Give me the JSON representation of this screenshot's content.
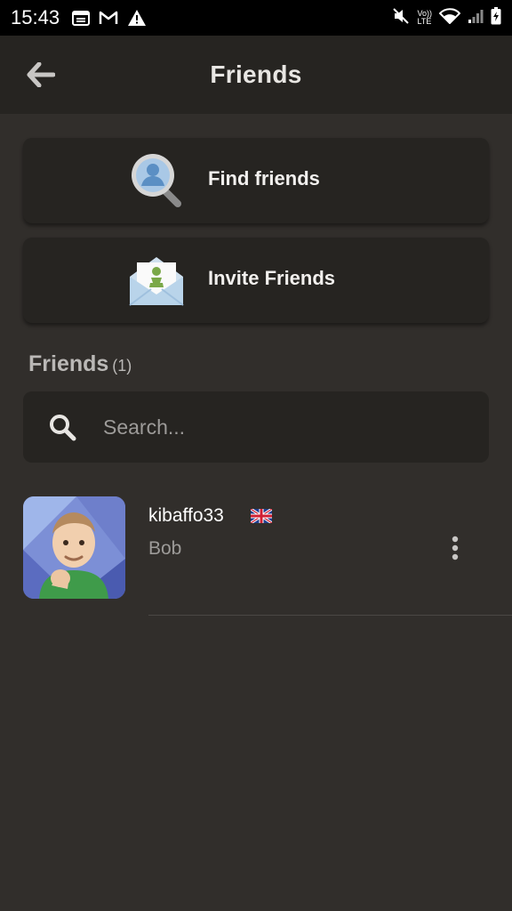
{
  "status_bar": {
    "time": "15:43",
    "left_icons": [
      "calendar-icon",
      "gmail-icon",
      "warning-icon"
    ],
    "right_icons": [
      "mute-icon",
      "volte-icon",
      "wifi-icon",
      "signal-icon",
      "battery-icon"
    ],
    "volte_top": "Vo))",
    "volte_bottom": "LTE"
  },
  "app_bar": {
    "title": "Friends"
  },
  "actions": [
    {
      "label": "Find friends",
      "icon": "magnifier-person-icon"
    },
    {
      "label": "Invite Friends",
      "icon": "envelope-pawn-icon"
    }
  ],
  "friends_section": {
    "title": "Friends",
    "count": "(1)"
  },
  "search": {
    "placeholder": "Search..."
  },
  "friends": [
    {
      "username": "kibaffo33",
      "real_name": "Bob",
      "country_flag": "uk-flag-icon",
      "avatar": "baby-fist-avatar"
    }
  ],
  "colors": {
    "background": "#312e2b",
    "card": "#262421",
    "appbar": "#262421",
    "text_primary": "#ffffff",
    "text_secondary": "#9d9b99"
  }
}
